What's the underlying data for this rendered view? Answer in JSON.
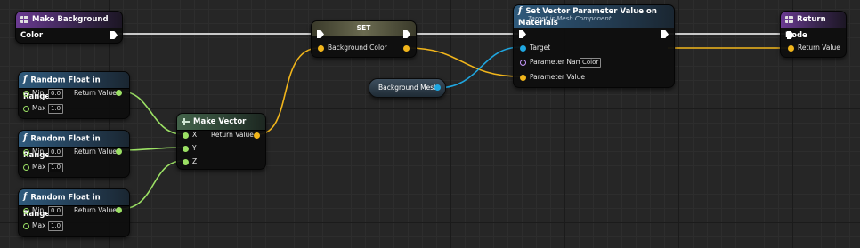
{
  "colors": {
    "exec": "#ffffff",
    "float_pin": "#9be064",
    "vector_pin": "#f1b51b",
    "object_pin": "#1fa6e0",
    "name_pin": "#c99aff",
    "function_header": "#2f5a7c",
    "entry_header": "#6a3a92"
  },
  "entry": {
    "title": "Make Background Color",
    "icon": "function-entry-icon"
  },
  "random_nodes": [
    {
      "title": "Random Float in Range",
      "icon": "function-icon",
      "min_label": "Min",
      "min_value": "0.0",
      "max_label": "Max",
      "max_value": "1.0",
      "return_label": "Return Value"
    },
    {
      "title": "Random Float in Range",
      "icon": "function-icon",
      "min_label": "Min",
      "min_value": "0.0",
      "max_label": "Max",
      "max_value": "1.0",
      "return_label": "Return Value"
    },
    {
      "title": "Random Float in Range",
      "icon": "function-icon",
      "min_label": "Min",
      "min_value": "0.0",
      "max_label": "Max",
      "max_value": "1.0",
      "return_label": "Return Value"
    }
  ],
  "make_vector": {
    "title": "Make Vector",
    "icon": "make-struct-icon",
    "x_label": "X",
    "y_label": "Y",
    "z_label": "Z",
    "return_label": "Return Value"
  },
  "set_node": {
    "title": "SET",
    "pin_label": "Background Color"
  },
  "variable_get": {
    "label": "Background Mesh"
  },
  "set_param": {
    "title": "Set Vector Parameter Value on Materials",
    "subtitle": "Target is Mesh Component",
    "icon": "function-icon",
    "target_label": "Target",
    "param_name_label": "Parameter Name",
    "param_name_value": "Color",
    "param_value_label": "Parameter Value"
  },
  "return_node": {
    "title": "Return Node",
    "icon": "function-result-icon",
    "return_label": "Return Value"
  }
}
